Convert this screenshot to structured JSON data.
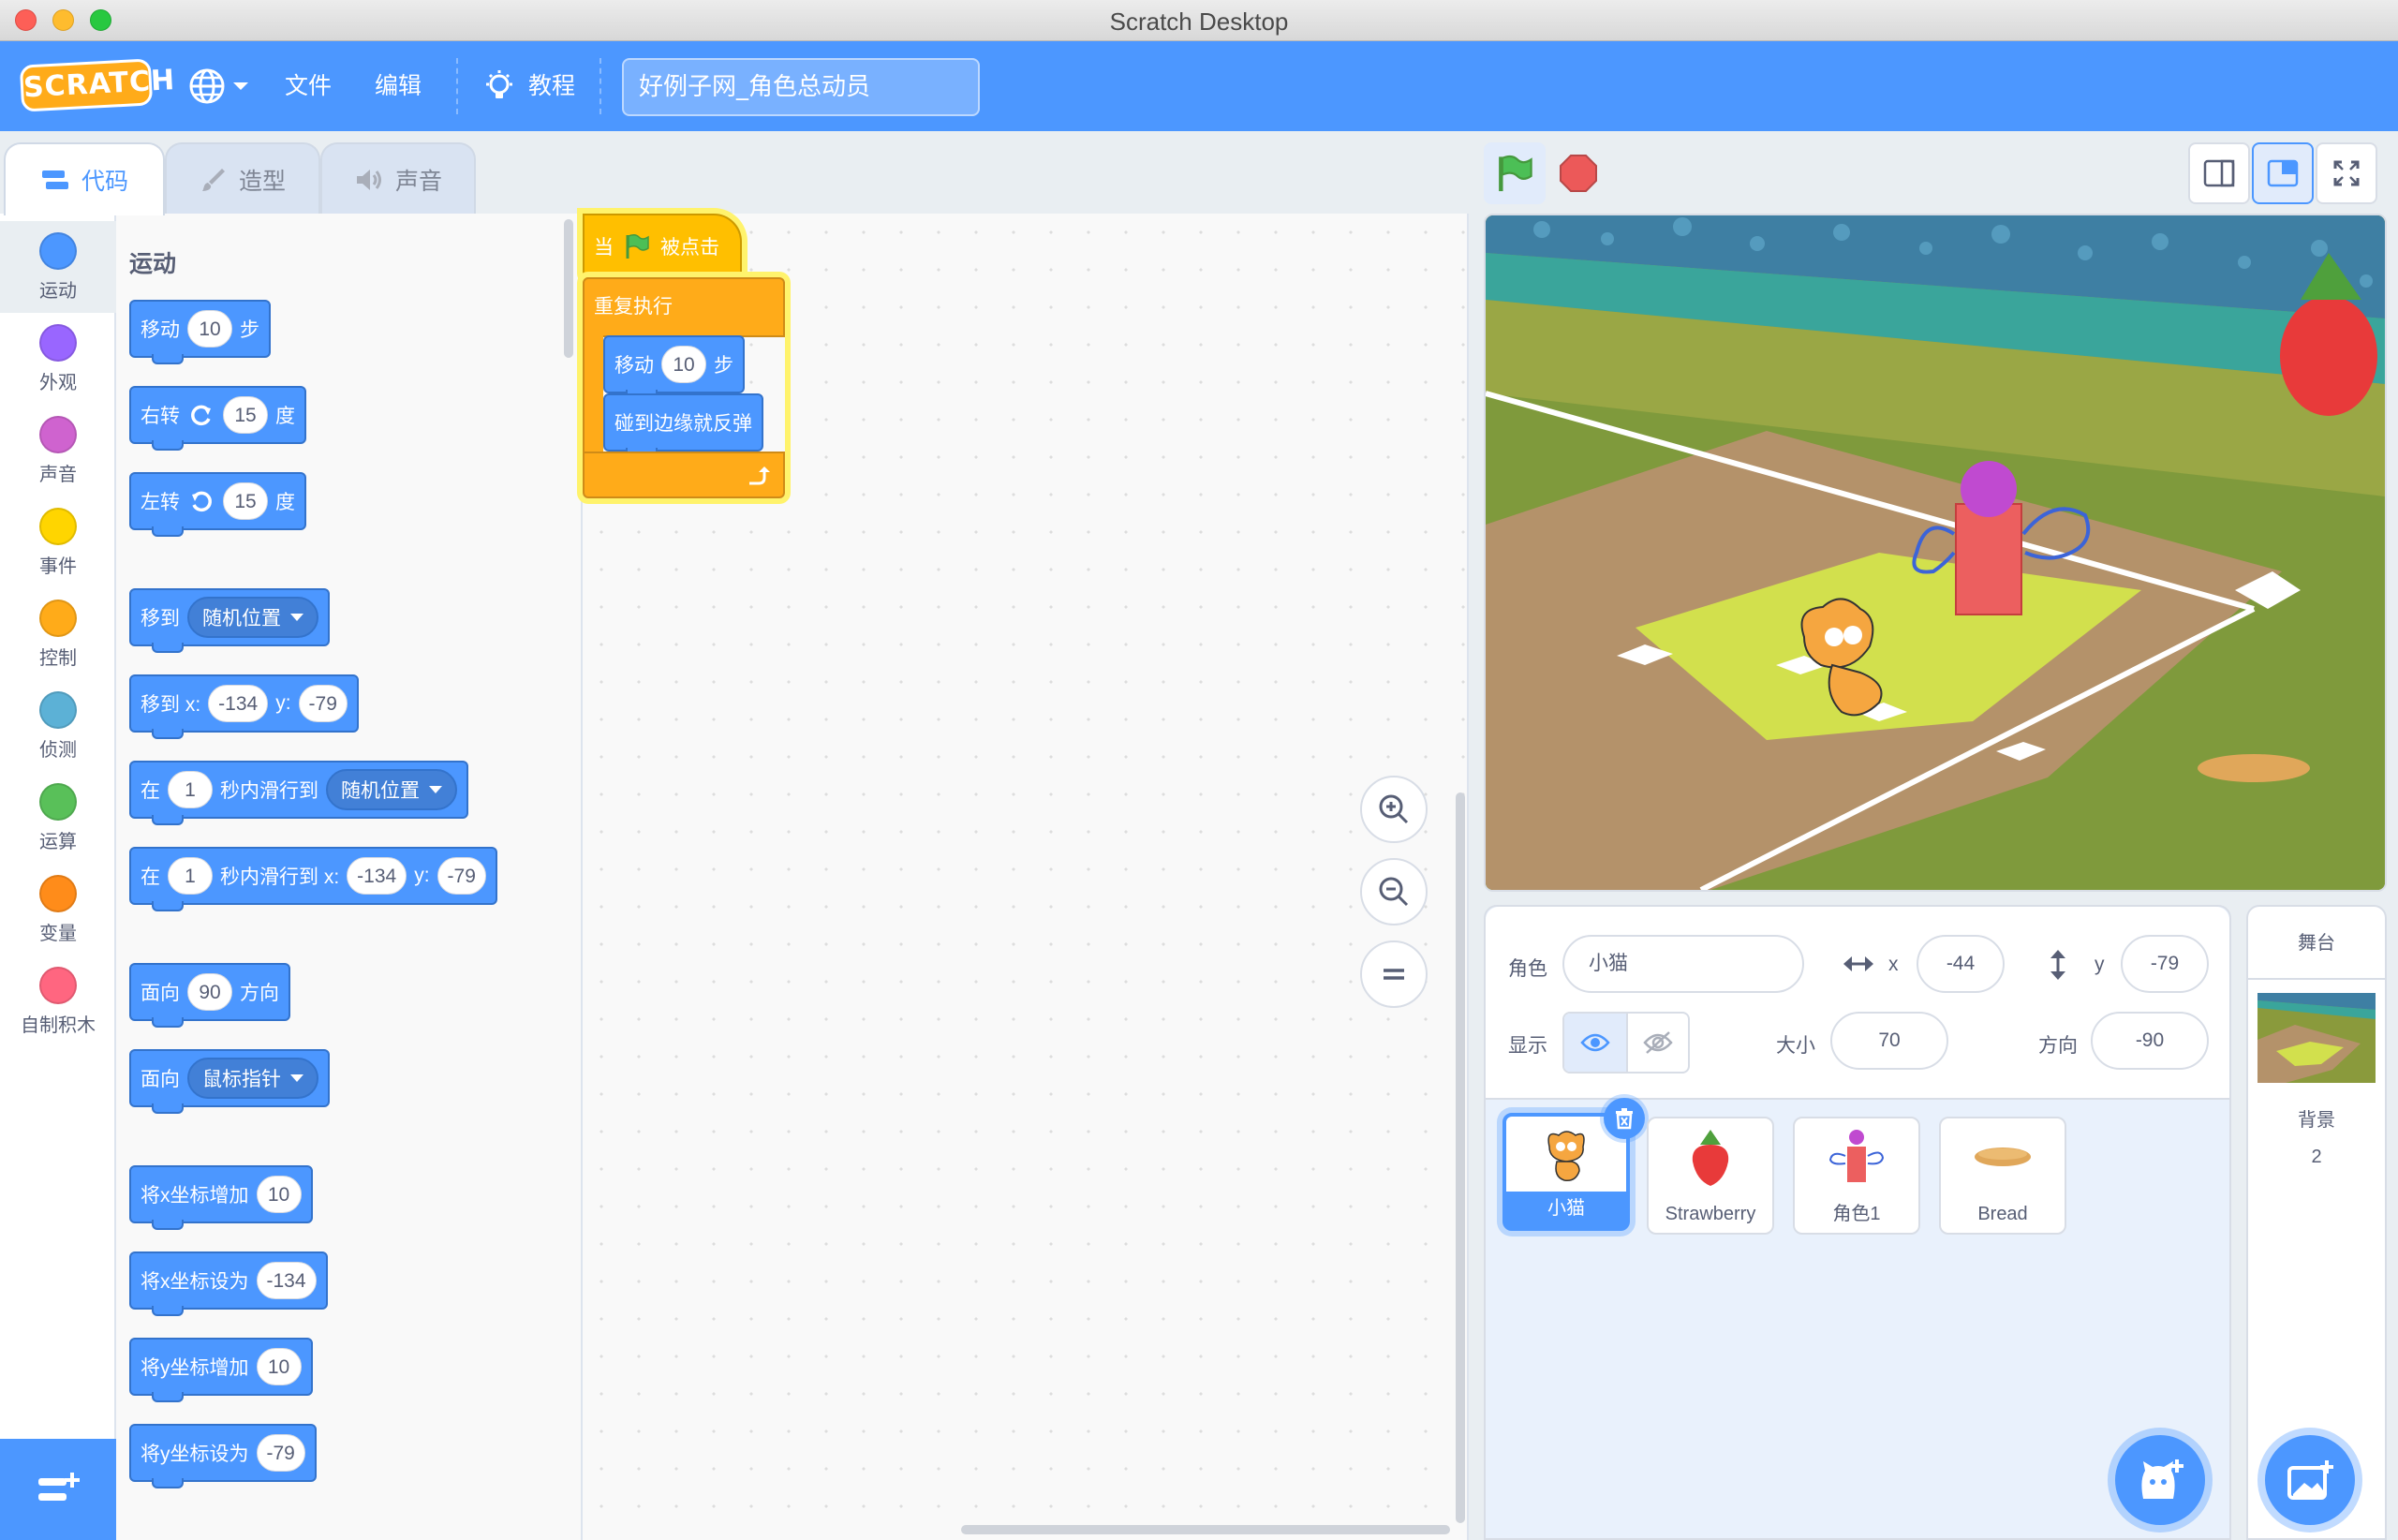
{
  "window": {
    "title": "Scratch Desktop"
  },
  "menubar": {
    "logo_text": "SCRATCH",
    "file": "文件",
    "edit": "编辑",
    "tutorials": "教程",
    "project_title": "好例子网_角色总动员"
  },
  "tabs": [
    {
      "label": "代码",
      "icon": "code-icon",
      "active": true
    },
    {
      "label": "造型",
      "icon": "brush-icon",
      "active": false
    },
    {
      "label": "声音",
      "icon": "speaker-icon",
      "active": false
    }
  ],
  "categories": [
    {
      "label": "运动",
      "color": "#4c97ff"
    },
    {
      "label": "外观",
      "color": "#9966ff"
    },
    {
      "label": "声音",
      "color": "#cf63cf"
    },
    {
      "label": "事件",
      "color": "#ffd500"
    },
    {
      "label": "控制",
      "color": "#ffab19"
    },
    {
      "label": "侦测",
      "color": "#5cb1d6"
    },
    {
      "label": "运算",
      "color": "#59c059"
    },
    {
      "label": "变量",
      "color": "#ff8c1a"
    },
    {
      "label": "自制积木",
      "color": "#ff6680"
    }
  ],
  "palette": {
    "section_title": "运动",
    "move": {
      "a": "移动",
      "n": "10",
      "b": "步"
    },
    "turn_right": {
      "a": "右转",
      "n": "15",
      "b": "度"
    },
    "turn_left": {
      "a": "左转",
      "n": "15",
      "b": "度"
    },
    "goto": {
      "a": "移到",
      "drop": "随机位置"
    },
    "goto_xy": {
      "a": "移到 x:",
      "x": "-134",
      "yl": "y:",
      "y": "-79"
    },
    "glide": {
      "a": "在",
      "n": "1",
      "b": "秒内滑行到",
      "drop": "随机位置"
    },
    "glide_xy": {
      "a": "在",
      "n": "1",
      "b": "秒内滑行到 x:",
      "x": "-134",
      "yl": "y:",
      "y": "-79"
    },
    "point_dir": {
      "a": "面向",
      "n": "90",
      "b": "方向"
    },
    "point_towards": {
      "a": "面向",
      "drop": "鼠标指针"
    },
    "change_x": {
      "a": "将x坐标增加",
      "n": "10"
    },
    "set_x": {
      "a": "将x坐标设为",
      "n": "-134"
    },
    "change_y": {
      "a": "将y坐标增加",
      "n": "10"
    },
    "set_y": {
      "a": "将y坐标设为",
      "n": "-79"
    }
  },
  "script": {
    "hat_when": "当",
    "hat_clicked": "被点击",
    "forever": "重复执行",
    "move_a": "移动",
    "move_n": "10",
    "move_b": "步",
    "bounce": "碰到边缘就反弹"
  },
  "sprite_info": {
    "sprite_label": "角色",
    "sprite_name": "小猫",
    "x_label": "x",
    "x": "-44",
    "y_label": "y",
    "y": "-79",
    "show_label": "显示",
    "size_label": "大小",
    "size": "70",
    "direction_label": "方向",
    "direction": "-90"
  },
  "sprites": [
    {
      "name": "小猫",
      "selected": true
    },
    {
      "name": "Strawberry",
      "selected": false
    },
    {
      "name": "角色1",
      "selected": false
    },
    {
      "name": "Bread",
      "selected": false
    }
  ],
  "stage_panel": {
    "title": "舞台",
    "backdrops_label": "背景",
    "backdrops_count": "2"
  }
}
